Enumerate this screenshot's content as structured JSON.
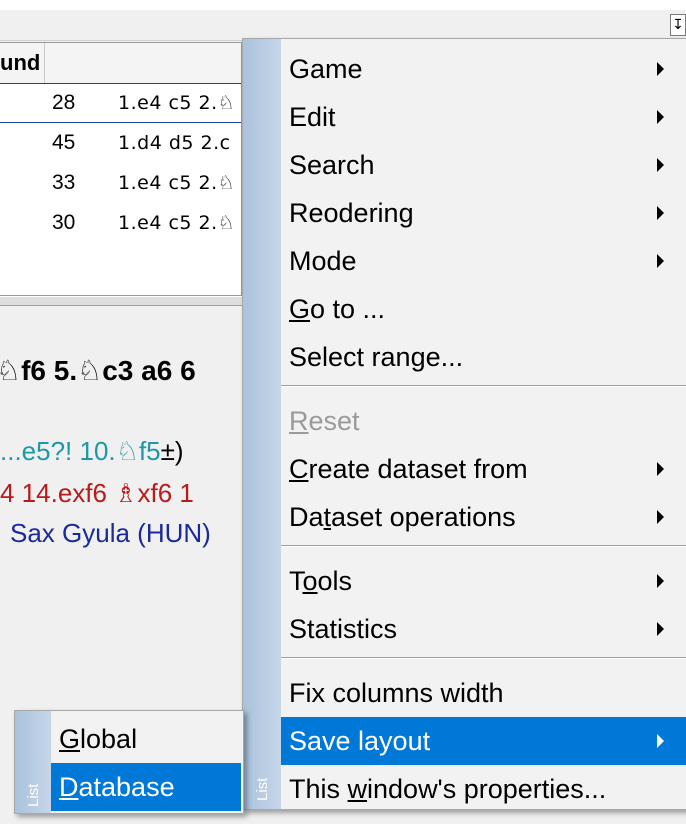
{
  "toolbar": {
    "button_glyph": "↧"
  },
  "game_list": {
    "header_round": "und",
    "rows": [
      {
        "round": "28",
        "moves": "1.e4 c5 2.♘"
      },
      {
        "round": "45",
        "moves": "1.d4 d5 2.c"
      },
      {
        "round": "33",
        "moves": "1.e4 c5 2.♘"
      },
      {
        "round": "30",
        "moves": "1.e4 c5 2.♘"
      }
    ]
  },
  "notation": {
    "line1": "♘f6 5.♘c3 a6 6",
    "line2_a": "...e5?! 10.♘f5",
    "line2_b": "±)",
    "line3": "4 14.exf6 ♗xf6 1",
    "line4": "Sax Gyula (HUN)"
  },
  "menu": {
    "side_label": "List",
    "items": [
      {
        "before": "",
        "ul": "",
        "after": "Game",
        "submenu": true
      },
      {
        "before": "",
        "ul": "",
        "after": "Edit",
        "submenu": true
      },
      {
        "before": "",
        "ul": "",
        "after": "Search",
        "submenu": true
      },
      {
        "before": "",
        "ul": "",
        "after": "Reodering",
        "submenu": true
      },
      {
        "before": "",
        "ul": "",
        "after": "Mode",
        "submenu": true
      },
      {
        "before": "",
        "ul": "G",
        "after": "o to ...",
        "submenu": false
      },
      {
        "before": "",
        "ul": "",
        "after": "Select range...",
        "submenu": false
      },
      {
        "before": "",
        "ul": "R",
        "after": "eset",
        "submenu": false,
        "disabled": true
      },
      {
        "before": "",
        "ul": "C",
        "after": "reate dataset from",
        "submenu": true
      },
      {
        "before": "Da",
        "ul": "t",
        "after": "aset operations",
        "submenu": true
      },
      {
        "before": "T",
        "ul": "o",
        "after": "ols",
        "submenu": true
      },
      {
        "before": "",
        "ul": "",
        "after": "Statistics",
        "submenu": true
      },
      {
        "before": "",
        "ul": "",
        "after": "Fix columns width",
        "submenu": false
      },
      {
        "before": "",
        "ul": "",
        "after": "Save layout",
        "submenu": true,
        "highlighted": true
      },
      {
        "before": "This ",
        "ul": "w",
        "after": "indow's properties...",
        "submenu": false
      }
    ]
  },
  "submenu": {
    "side_label": "List",
    "items": [
      {
        "before": "",
        "ul": "G",
        "after": "lobal"
      },
      {
        "before": "",
        "ul": "D",
        "after": "atabase",
        "highlighted": true
      }
    ]
  },
  "colors": {
    "highlight": "#0078d7",
    "menu_bar": "#aac2dc",
    "notation_variation": "#1b9aa6",
    "notation_comment": "#b71c1c",
    "notation_players": "#1a2a9a"
  }
}
